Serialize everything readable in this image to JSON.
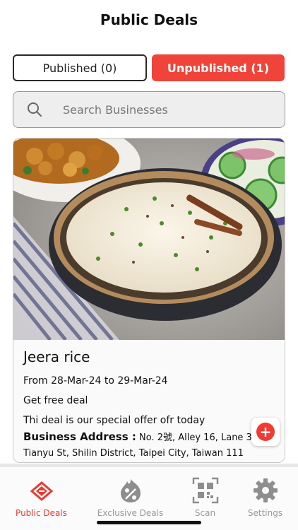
{
  "header": {
    "title": "Public Deals"
  },
  "tabs": {
    "published": "Published (0)",
    "unpublished": "Unpublished (1)"
  },
  "search": {
    "placeholder": "Search Businesses"
  },
  "deal": {
    "title": "Jeera rice",
    "dates": "From 28-Mar-24 to 29-Mar-24",
    "offer": "Get free deal",
    "description": "Thi deal is our special offer ofr today",
    "address_label": "Business Address :",
    "address_line1": "No. 2號, Alley 16, Lane 38",
    "address_line2": "Tianyu St, Shilin District, Taipei City, Taiwan 111"
  },
  "fab": {
    "icon": "plus-icon",
    "symbol": "+"
  },
  "nav": {
    "items": [
      {
        "label": "Public Deals",
        "icon": "public-deals-icon",
        "active": true
      },
      {
        "label": "Exclusive Deals",
        "icon": "percent-badge-icon",
        "active": false
      },
      {
        "label": "Scan",
        "icon": "qr-code-icon",
        "active": false
      },
      {
        "label": "Settings",
        "icon": "gear-icon",
        "active": false
      }
    ]
  },
  "colors": {
    "accent": "#f0443a",
    "inactive": "#999999"
  }
}
